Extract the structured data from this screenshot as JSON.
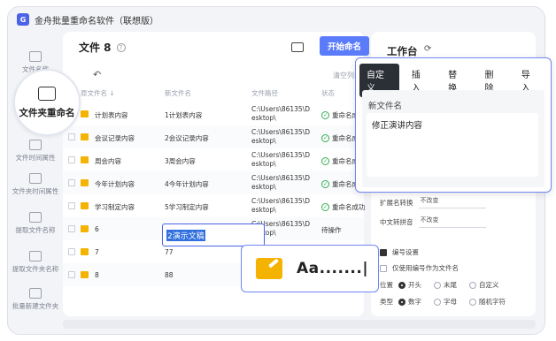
{
  "app": {
    "title": "金舟批量重命名软件（联想版）",
    "logo_text": "G"
  },
  "sidebar": {
    "items": [
      {
        "label": "文件名称"
      },
      {
        "label": "文件夹重命名"
      },
      {
        "label": "文件时间属性"
      },
      {
        "label": "文件夹时间属性"
      },
      {
        "label": "提取文件名称"
      },
      {
        "label": "提取文件夹名称"
      },
      {
        "label": "批量新建文件夹"
      }
    ],
    "bubble_label": "文件夹重命名"
  },
  "main": {
    "title": "文件 8",
    "help": "?",
    "start_button": "开始命名",
    "undo": "↶",
    "clear": "清空列表",
    "columns": [
      "原文件名 ↓",
      "新文件名",
      "文件路径",
      "状态"
    ],
    "rows": [
      {
        "orig": "计划表内容",
        "new": "1计划表内容",
        "path1": "C:\\Users\\86135\\D",
        "path2": "esktop\\",
        "status": "重命名成功",
        "ok": true
      },
      {
        "orig": "会议记录内容",
        "new": "2会议记录内容",
        "path1": "C:\\Users\\86135\\D",
        "path2": "esktop\\",
        "status": "重命名成功",
        "ok": true
      },
      {
        "orig": "周会内容",
        "new": "3周会内容",
        "path1": "C:\\Users\\86135\\D",
        "path2": "esktop\\",
        "status": "重命名成功",
        "ok": true
      },
      {
        "orig": "今年计划内容",
        "new": "4今年计划内容",
        "path1": "C:\\Users\\86135\\D",
        "path2": "esktop\\",
        "status": "重命名成功",
        "ok": true
      },
      {
        "orig": "学习制定内容",
        "new": "5学习制定内容",
        "path1": "C:\\Users\\86135\\D",
        "path2": "esktop\\",
        "status": "重命名成功",
        "ok": true
      },
      {
        "orig": "6",
        "new": "",
        "path1": "C:\\Users\\86135\\D",
        "path2": "esktop\\",
        "status": "待操作",
        "ok": false
      },
      {
        "orig": "7",
        "new": "77",
        "path1": "",
        "path2": "",
        "status": "",
        "ok": false
      },
      {
        "orig": "8",
        "new": "88",
        "path1": "",
        "path2": "",
        "status": "",
        "ok": false
      }
    ],
    "editing_value": "2演示文稿"
  },
  "workbench": {
    "title": "工作台",
    "refresh": "⟳",
    "ext_label": "扩展名转换",
    "ext_value": "不改变",
    "pinyin_label": "中文转拼音",
    "pinyin_value": "不改变",
    "numbering_label": "编号设置",
    "only_number_label": "仅使用编号作为文件名",
    "position_label": "位置",
    "position_options": [
      "开头",
      "末尾",
      "自定义"
    ],
    "type_label": "类型",
    "type_options": [
      "数字",
      "字母",
      "随机字符"
    ]
  },
  "popup": {
    "tabs": [
      "自定义",
      "插入",
      "替换",
      "删除",
      "导入"
    ],
    "active_tab": "自定义",
    "new_name_label": "新文件名",
    "new_name_value": "修正演讲内容"
  },
  "aa_callout": {
    "text": "Aa.......|"
  }
}
